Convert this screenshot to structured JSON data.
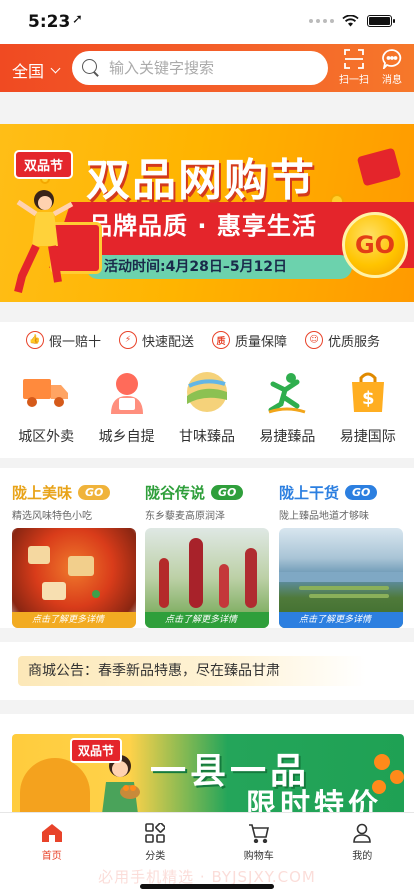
{
  "status": {
    "time": "5:23",
    "location_arrow": "➚"
  },
  "header": {
    "region": "全国",
    "search_placeholder": "输入关键字搜索",
    "scan_label": "扫一扫",
    "message_label": "消息"
  },
  "banner": {
    "tag": "双品节",
    "title": "双品网购节",
    "subtitle": "品牌品质 · 惠享生活",
    "date": "活动时间:4月28日–5月12日",
    "go": "GO"
  },
  "guarantees": [
    {
      "icon": "thumb-icon",
      "glyph": "👍",
      "label": "假一赔十"
    },
    {
      "icon": "delivery-icon",
      "glyph": "⚡",
      "label": "快速配送"
    },
    {
      "icon": "shield-icon",
      "glyph": "质",
      "label": "质量保障"
    },
    {
      "icon": "service-icon",
      "glyph": "☺",
      "label": "优质服务"
    }
  ],
  "categories": [
    {
      "label": "城区外卖",
      "icon": "truck-icon",
      "color": "#ff8a3d"
    },
    {
      "label": "城乡自提",
      "icon": "courier-icon",
      "color": "#ff6b5a"
    },
    {
      "label": "甘味臻品",
      "icon": "field-icon",
      "color": "#f0b84a"
    },
    {
      "label": "易捷臻品",
      "icon": "runner-icon",
      "color": "#2fae4e"
    },
    {
      "label": "易捷国际",
      "icon": "shopping-bag-icon",
      "color": "#ffae21"
    }
  ],
  "promos": [
    {
      "name": "陇上美味",
      "go": "GO",
      "sub": "精选风味特色小吃",
      "cta": "点击了解更多详情",
      "color": "#e8a318"
    },
    {
      "name": "陇谷传说",
      "go": "GO",
      "sub": "东乡藜麦高原润泽",
      "cta": "点击了解更多详情",
      "color": "#2f9f3b"
    },
    {
      "name": "陇上干货",
      "go": "GO",
      "sub": "陇上臻品地道才够味",
      "cta": "点击了解更多详情",
      "color": "#2c7fe0"
    }
  ],
  "notice": "商城公告：春季新品特惠，尽在臻品甘肃",
  "bottom_banner": {
    "tag": "双品节",
    "title": "一县一品",
    "title2": "限时特价"
  },
  "tabs": [
    {
      "label": "首页",
      "icon": "home-icon"
    },
    {
      "label": "分类",
      "icon": "grid-icon"
    },
    {
      "label": "购物车",
      "icon": "cart-icon"
    },
    {
      "label": "我的",
      "icon": "user-icon"
    }
  ],
  "watermark": "必用手机精选 · BYJSJXY.COM",
  "colors": {
    "brand": "#f04a22",
    "active_tab": "#e8432a"
  }
}
